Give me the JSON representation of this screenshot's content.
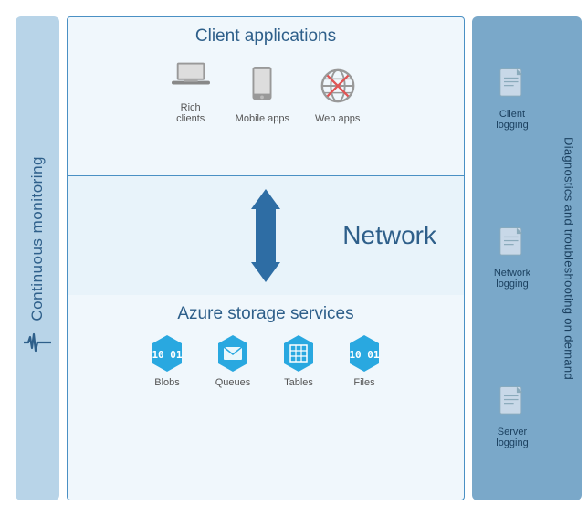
{
  "diagram": {
    "left_label": "Continuous monitoring",
    "right_label": "Diagnostics and troubleshooting on demand",
    "client_tier": {
      "title": "Client applications",
      "icons": [
        {
          "label": "Rich\nclients",
          "type": "laptop"
        },
        {
          "label": "Mobile apps",
          "type": "mobile"
        },
        {
          "label": "Web apps",
          "type": "globe"
        }
      ]
    },
    "network_tier": {
      "title": "Network"
    },
    "storage_tier": {
      "title": "Azure storage services",
      "icons": [
        {
          "label": "Blobs",
          "type": "hex-blobs",
          "color": "#29a8e0"
        },
        {
          "label": "Queues",
          "type": "hex-queues",
          "color": "#29a8e0"
        },
        {
          "label": "Tables",
          "type": "hex-tables",
          "color": "#29a8e0"
        },
        {
          "label": "Files",
          "type": "hex-files",
          "color": "#29a8e0"
        }
      ]
    },
    "right_panel_items": [
      {
        "label": "Client\nlogging",
        "type": "doc"
      },
      {
        "label": "Network\nlogging",
        "type": "doc"
      },
      {
        "label": "Server\nlogging",
        "type": "doc"
      }
    ]
  }
}
